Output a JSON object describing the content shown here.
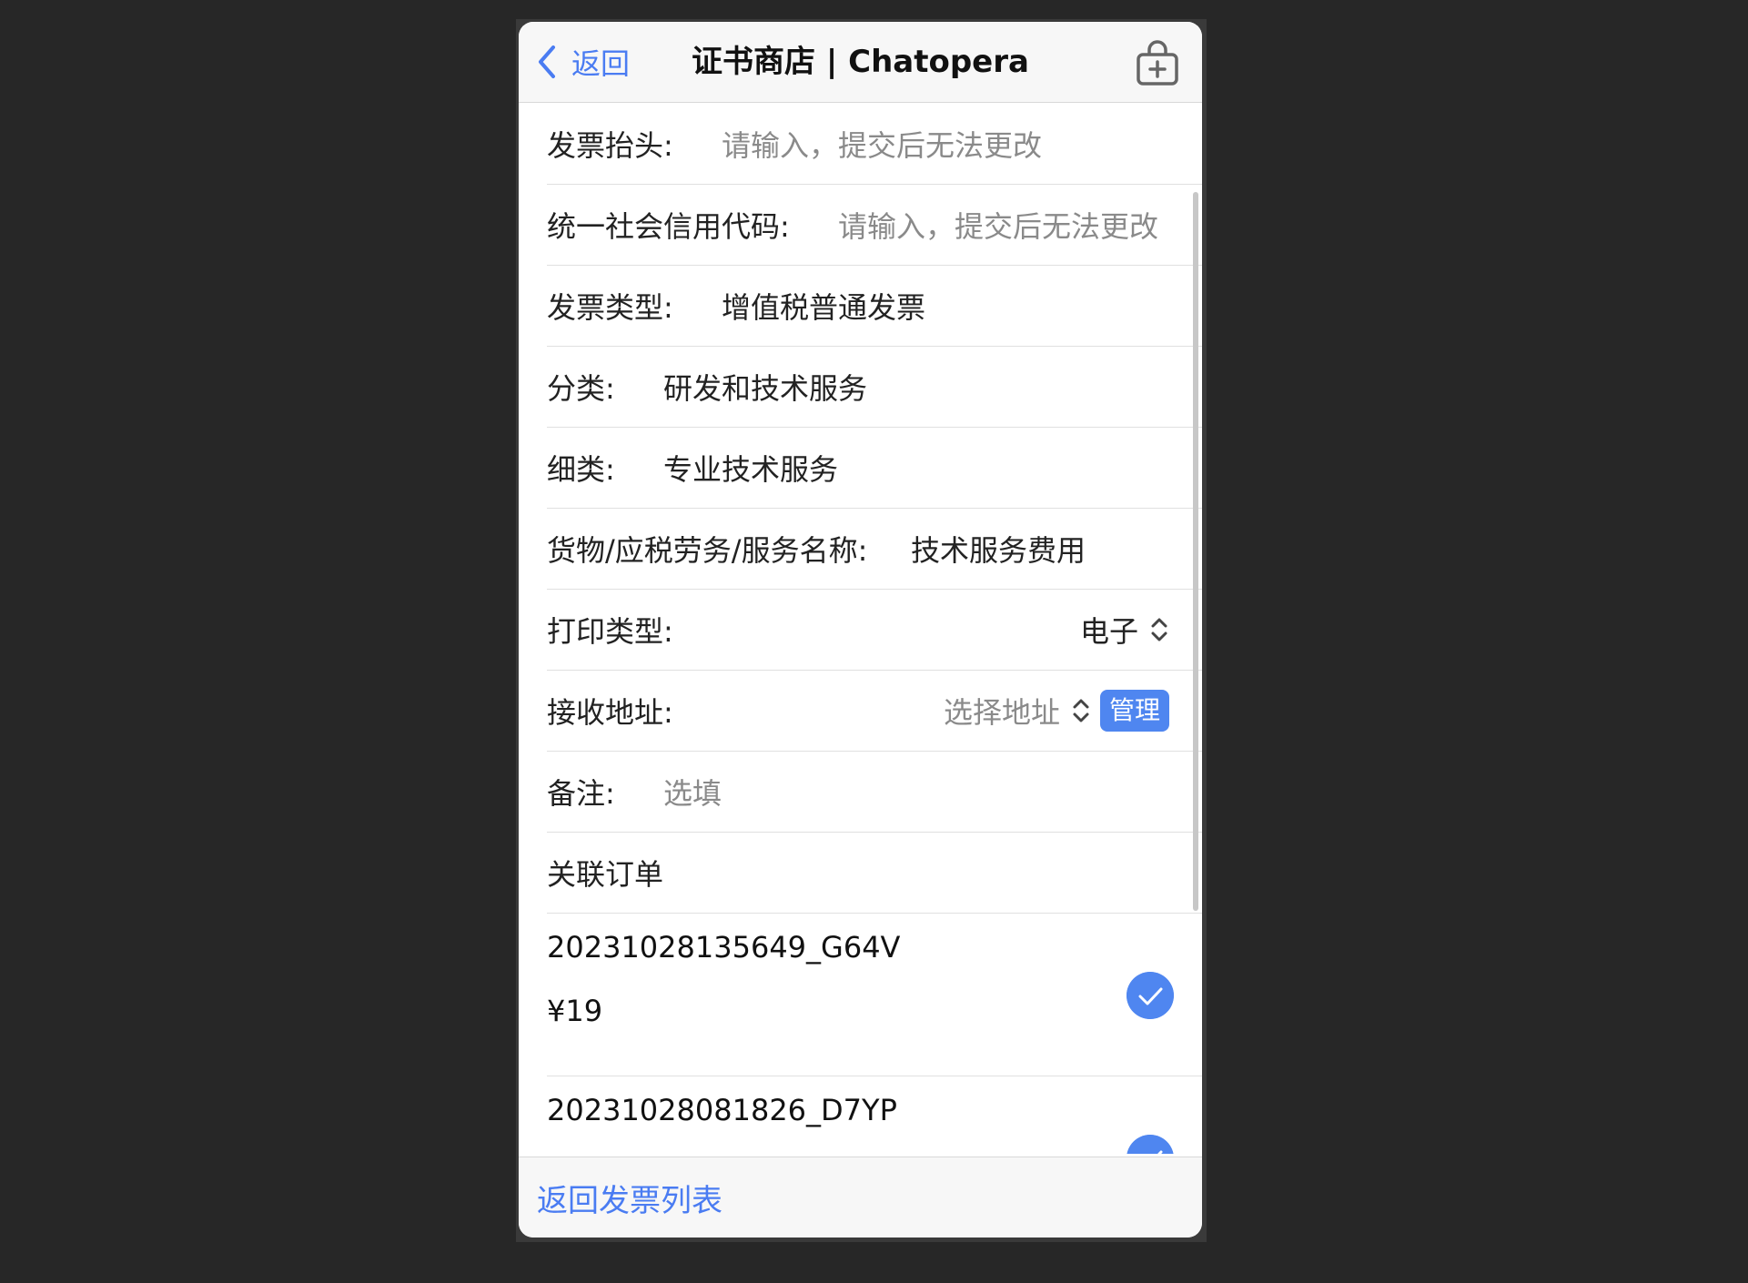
{
  "nav": {
    "back_label": "返回",
    "title": "证书商店 | Chatopera"
  },
  "form": {
    "invoice_title": {
      "label": "发票抬头:",
      "placeholder": "请输入，提交后无法更改"
    },
    "credit_code": {
      "label": "统一社会信用代码:",
      "placeholder": "请输入，提交后无法更改"
    },
    "invoice_type": {
      "label": "发票类型:",
      "value": "增值税普通发票"
    },
    "category": {
      "label": "分类:",
      "value": "研发和技术服务"
    },
    "subcategory": {
      "label": "细类:",
      "value": "专业技术服务"
    },
    "goods_name": {
      "label": "货物/应税劳务/服务名称:",
      "value": "技术服务费用"
    },
    "print_type": {
      "label": "打印类型:",
      "value": "电子"
    },
    "address": {
      "label": "接收地址:",
      "value": "选择地址",
      "manage_label": "管理"
    },
    "remark": {
      "label": "备注:",
      "placeholder": "选填"
    },
    "linked_orders_label": "关联订单"
  },
  "orders": [
    {
      "id": "20231028135649_G64V",
      "price": "¥19",
      "checked": true
    },
    {
      "id": "20231028081826_D7YP",
      "checked": true
    }
  ],
  "bottom": {
    "link_label": "返回发票列表"
  },
  "colors": {
    "accent": "#4a7cf2",
    "check_bg": "#4f86f0",
    "page_bg": "#272727"
  }
}
